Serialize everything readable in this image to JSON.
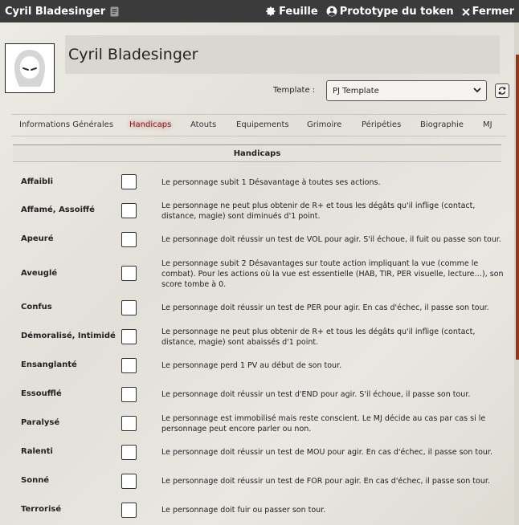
{
  "window": {
    "title": "Cyril Bladesinger",
    "buttons": {
      "sheet": "Feuille",
      "token": "Prototype du token",
      "close": "Fermer"
    }
  },
  "character": {
    "name": "Cyril Bladesinger",
    "template_label": "Template :",
    "template_value": "PJ Template"
  },
  "tabs": [
    "Informations Générales",
    "Handicaps",
    "Atouts",
    "Equipements",
    "Grimoire",
    "Péripéties",
    "Biographie",
    "MJ"
  ],
  "active_tab": "Handicaps",
  "section": {
    "title": "Handicaps"
  },
  "handicaps": [
    {
      "name": "Affaibli",
      "desc": "Le personnage subit 1 Désavantage à toutes ses actions."
    },
    {
      "name": "Affamé, Assoiffé",
      "desc": "Le personnage ne peut plus obtenir de R+ et tous les dégâts qu'il inflige (contact, distance, magie) sont diminués d'1 point."
    },
    {
      "name": "Apeuré",
      "desc": "Le personnage doit réussir un test de VOL pour agir. S'il échoue, il fuit ou passe son tour."
    },
    {
      "name": "Aveuglé",
      "desc": "Le personnage subit 2 Désavantages sur toute action impliquant la vue (comme le combat). Pour les actions où la vue est essentielle (HAB, TIR, PER visuelle, lecture…), son score tombe à 0."
    },
    {
      "name": "Confus",
      "desc": "Le personnage doit réussir un test de PER pour agir. En cas d'échec, il passe son tour."
    },
    {
      "name": "Démoralisé, Intimidé",
      "desc": "Le personnage ne peut plus obtenir de R+ et tous les dégâts qu'il inflige (contact, distance, magie) sont abaissés d'1 point."
    },
    {
      "name": "Ensanglanté",
      "desc": "Le personnage perd 1 PV au début de son tour."
    },
    {
      "name": "Essoufflé",
      "desc": "Le personnage doit réussir un test d'END pour agir. S'il échoue, il passe son tour."
    },
    {
      "name": "Paralysé",
      "desc": "Le personnage est immobilisé mais reste conscient. Le MJ décide au cas par cas si le personnage peut encore parler ou non."
    },
    {
      "name": "Ralenti",
      "desc": "Le personnage doit réussir un test de MOU pour agir. En cas d'échec, il passe son tour."
    },
    {
      "name": "Sonné",
      "desc": "Le personnage doit réussir un test de FOR pour agir. En cas d'échec, il passe son tour."
    },
    {
      "name": "Terrorisé",
      "desc": "Le personnage doit fuir ou passer son tour."
    }
  ]
}
